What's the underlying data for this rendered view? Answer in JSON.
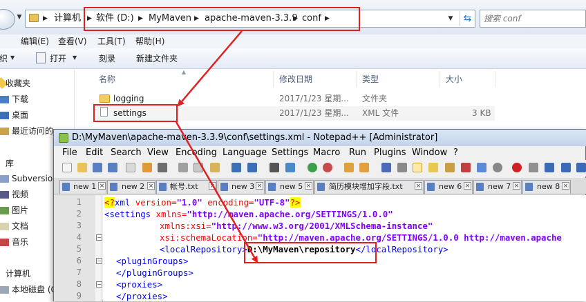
{
  "explorer": {
    "breadcrumb": [
      "计算机",
      "软件 (D:)",
      "MyMaven",
      "apache-maven-3.3.9",
      "conf"
    ],
    "search_placeholder": "搜索 conf",
    "menu": [
      "编辑(E)",
      "查看(V)",
      "工具(T)",
      "帮助(H)"
    ],
    "toolbar": {
      "organize_partial": "织",
      "open": "打开",
      "burn": "刻录",
      "new_folder": "新建文件夹"
    },
    "nav": [
      "收藏夹",
      "下载",
      "桌面",
      "最近访问的",
      "库",
      "Subversion",
      "视频",
      "图片",
      "文档",
      "音乐",
      "计算机",
      "本地磁盘 (C"
    ],
    "columns": {
      "name": "名称",
      "date": "修改日期",
      "type": "类型",
      "size": "大小"
    },
    "files": [
      {
        "name": "logging",
        "date": "2017/1/23 星期...",
        "type": "文件夹",
        "size": ""
      },
      {
        "name": "settings",
        "date": "2017/1/23 星期...",
        "type": "XML 文件",
        "size": "3 KB"
      }
    ]
  },
  "notepad": {
    "title": "D:\\MyMaven\\apache-maven-3.3.9\\conf\\settings.xml - Notepad++ [Administrator]",
    "menu": [
      "File",
      "Edit",
      "Search",
      "View",
      "Encoding",
      "Language",
      "Settings",
      "Macro",
      "Run",
      "Plugins",
      "Window",
      "?"
    ],
    "tabs": [
      "new 1",
      "new 2",
      "帐号.txt",
      "new 3",
      "new 5",
      "简历模块增加字段.txt",
      "new 6",
      "new 7",
      "new 8"
    ],
    "line_numbers": [
      "1",
      "2",
      "3",
      "4",
      "5",
      "6",
      "7",
      "8",
      "9"
    ],
    "code": {
      "l1_open": "<?",
      "l1_tag": "xml",
      "l1_attr1": " version=",
      "l1_val1": "\"1.0\"",
      "l1_attr2": " encoding=",
      "l1_val2": "\"UTF-8\"",
      "l1_close": "?>",
      "l2_tag": "<settings",
      "l2_attr": " xmlns=",
      "l2_val": "\"http://maven.apache.org/SETTINGS/1.0.0\"",
      "l3_attr": "xmlns:xsi=",
      "l3_val": "\"http://www.w3.org/2001/XMLSchema-instance\"",
      "l4_attr": "xsi:schemaLocation=",
      "l4_val": "\"http://maven.apache.org/SETTINGS/1.0.0 http://maven.apache",
      "l5_open": "<localRepository>",
      "l5_text": "D:\\MyMaven\\repository",
      "l5_close": "</localRepository>",
      "l6": "<pluginGroups>",
      "l7": "</pluginGroups>",
      "l8": "<proxies>",
      "l9": "</proxies>"
    }
  },
  "accent_colors": {
    "annotation_red": "#e02020",
    "xml_tag": "#0000ff",
    "xml_attr": "#ff0000",
    "xml_value": "#8000ff"
  }
}
